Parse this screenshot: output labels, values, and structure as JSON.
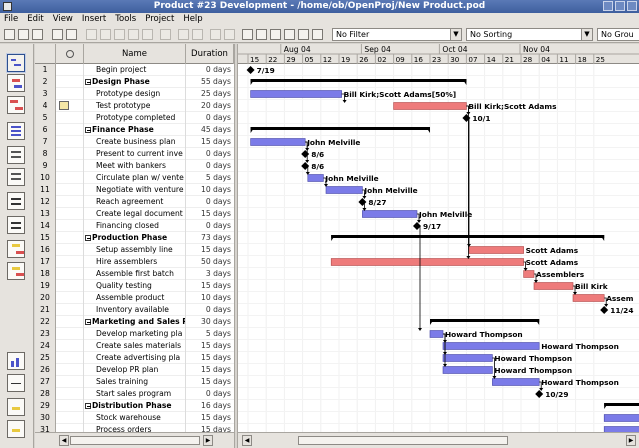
{
  "window": {
    "title": "Product #23 Development - /home/ob/OpenProj/New Product.pod"
  },
  "menu": [
    "File",
    "Edit",
    "View",
    "Insert",
    "Tools",
    "Project",
    "Help"
  ],
  "toolbar": {
    "filter": "No Filter",
    "sorting": "No Sorting",
    "grouping": "No Grou"
  },
  "left_views": [
    "gantt-view-icon",
    "network-view-icon",
    "wbs-view-icon",
    "rbs-view-icon",
    "task-usage-icon",
    "resource-usage-icon",
    "project-view-icon",
    "resource-view-icon",
    "histogram-icon",
    "charts-icon",
    "report-icon"
  ],
  "table": {
    "headers": {
      "info": "",
      "name": "Name",
      "duration": "Duration"
    },
    "rows": [
      {
        "id": "1",
        "name": "Begin project",
        "duration": "0 days",
        "level": 1,
        "summary": false,
        "note": false
      },
      {
        "id": "2",
        "name": "Design Phase",
        "duration": "55 days",
        "level": 0,
        "summary": true,
        "note": false
      },
      {
        "id": "3",
        "name": "Prototype design",
        "duration": "25 days",
        "level": 1,
        "summary": false,
        "note": false
      },
      {
        "id": "4",
        "name": "Test prototype",
        "duration": "20 days",
        "level": 1,
        "summary": false,
        "note": true
      },
      {
        "id": "5",
        "name": "Prototype completed",
        "duration": "0 days",
        "level": 1,
        "summary": false,
        "note": false
      },
      {
        "id": "6",
        "name": "Finance Phase",
        "duration": "45 days",
        "level": 0,
        "summary": true,
        "note": false
      },
      {
        "id": "7",
        "name": "Create business plan",
        "duration": "15 days",
        "level": 1,
        "summary": false,
        "note": false
      },
      {
        "id": "8",
        "name": "Present to current inve",
        "duration": "0 days",
        "level": 1,
        "summary": false,
        "note": false
      },
      {
        "id": "9",
        "name": "Meet with bankers",
        "duration": "0 days",
        "level": 1,
        "summary": false,
        "note": false
      },
      {
        "id": "10",
        "name": "Circulate plan w/ vente",
        "duration": "5 days",
        "level": 1,
        "summary": false,
        "note": false
      },
      {
        "id": "11",
        "name": "Negotiate with venture",
        "duration": "10 days",
        "level": 1,
        "summary": false,
        "note": false
      },
      {
        "id": "12",
        "name": "Reach agreement",
        "duration": "0 days",
        "level": 1,
        "summary": false,
        "note": false
      },
      {
        "id": "13",
        "name": "Create legal document",
        "duration": "15 days",
        "level": 1,
        "summary": false,
        "note": false
      },
      {
        "id": "14",
        "name": "Financing closed",
        "duration": "0 days",
        "level": 1,
        "summary": false,
        "note": false
      },
      {
        "id": "15",
        "name": "Production Phase",
        "duration": "73 days",
        "level": 0,
        "summary": true,
        "note": false
      },
      {
        "id": "16",
        "name": "Setup assembly line",
        "duration": "15 days",
        "level": 1,
        "summary": false,
        "note": false
      },
      {
        "id": "17",
        "name": "Hire assemblers",
        "duration": "50 days",
        "level": 1,
        "summary": false,
        "note": false
      },
      {
        "id": "18",
        "name": "Assemble first batch",
        "duration": "3 days",
        "level": 1,
        "summary": false,
        "note": false
      },
      {
        "id": "19",
        "name": "Quality testing",
        "duration": "15 days",
        "level": 1,
        "summary": false,
        "note": false
      },
      {
        "id": "20",
        "name": "Assemble product",
        "duration": "10 days",
        "level": 1,
        "summary": false,
        "note": false
      },
      {
        "id": "21",
        "name": "Inventory available",
        "duration": "0 days",
        "level": 1,
        "summary": false,
        "note": false
      },
      {
        "id": "22",
        "name": "Marketing and Sales P",
        "duration": "30 days",
        "level": 0,
        "summary": true,
        "note": false
      },
      {
        "id": "23",
        "name": "Develop marketing pla",
        "duration": "5 days",
        "level": 1,
        "summary": false,
        "note": false
      },
      {
        "id": "24",
        "name": "Create sales materials",
        "duration": "15 days",
        "level": 1,
        "summary": false,
        "note": false
      },
      {
        "id": "25",
        "name": "Create advertising pla",
        "duration": "15 days",
        "level": 1,
        "summary": false,
        "note": false
      },
      {
        "id": "26",
        "name": "Develop PR plan",
        "duration": "15 days",
        "level": 1,
        "summary": false,
        "note": false
      },
      {
        "id": "27",
        "name": "Sales training",
        "duration": "15 days",
        "level": 1,
        "summary": false,
        "note": false
      },
      {
        "id": "28",
        "name": "Start sales program",
        "duration": "0 days",
        "level": 1,
        "summary": false,
        "note": false
      },
      {
        "id": "29",
        "name": "Distribution Phase",
        "duration": "16 days",
        "level": 0,
        "summary": true,
        "note": false
      },
      {
        "id": "30",
        "name": "Stock warehouse",
        "duration": "15 days",
        "level": 1,
        "summary": false,
        "note": false
      },
      {
        "id": "31",
        "name": "Process orders",
        "duration": "15 days",
        "level": 1,
        "summary": false,
        "note": false
      }
    ]
  },
  "gantt": {
    "months": [
      "Aug 04",
      "Sep 04",
      "Oct 04",
      "Nov 04"
    ],
    "days": [
      "15",
      "22",
      "29",
      "05",
      "12",
      "19",
      "26",
      "02",
      "09",
      "16",
      "23",
      "30",
      "07",
      "14",
      "21",
      "28",
      "04",
      "11",
      "18",
      "25"
    ],
    "colors": {
      "task_normal": "#7b7be8",
      "task_critical": "#ee7b7b",
      "summary": "#000000",
      "link": "#000000"
    },
    "bars": [
      {
        "row": 1,
        "kind": "milestone",
        "day": 1,
        "label": "7/19"
      },
      {
        "row": 2,
        "kind": "summary",
        "start": 1,
        "end": 84
      },
      {
        "row": 3,
        "kind": "task",
        "start": 1,
        "end": 36,
        "critical": false,
        "label": "Bill Kirk;Scott Adams[50%]"
      },
      {
        "row": 4,
        "kind": "task",
        "start": 56,
        "end": 84,
        "critical": true,
        "label": "Bill Kirk;Scott Adams"
      },
      {
        "row": 5,
        "kind": "milestone",
        "day": 84,
        "label": "10/1"
      },
      {
        "row": 6,
        "kind": "summary",
        "start": 1,
        "end": 70
      },
      {
        "row": 7,
        "kind": "task",
        "start": 1,
        "end": 22,
        "critical": false,
        "label": "John Melville"
      },
      {
        "row": 8,
        "kind": "milestone",
        "day": 22,
        "label": "8/6"
      },
      {
        "row": 9,
        "kind": "milestone",
        "day": 22,
        "label": "8/6"
      },
      {
        "row": 10,
        "kind": "task",
        "start": 23,
        "end": 29,
        "critical": false,
        "label": "John Melville"
      },
      {
        "row": 11,
        "kind": "task",
        "start": 30,
        "end": 44,
        "critical": false,
        "label": "John Melville"
      },
      {
        "row": 12,
        "kind": "milestone",
        "day": 44,
        "label": "8/27"
      },
      {
        "row": 13,
        "kind": "task",
        "start": 44,
        "end": 65,
        "critical": false,
        "label": "John Melville"
      },
      {
        "row": 14,
        "kind": "milestone",
        "day": 65,
        "label": "9/17"
      },
      {
        "row": 15,
        "kind": "summary",
        "start": 32,
        "end": 137
      },
      {
        "row": 16,
        "kind": "task",
        "start": 85,
        "end": 106,
        "critical": true,
        "label": "Scott Adams"
      },
      {
        "row": 17,
        "kind": "task",
        "start": 32,
        "end": 106,
        "critical": true,
        "label": "Scott Adams"
      },
      {
        "row": 18,
        "kind": "task",
        "start": 106,
        "end": 110,
        "critical": true,
        "label": "Assemblers"
      },
      {
        "row": 19,
        "kind": "task",
        "start": 110,
        "end": 125,
        "critical": true,
        "label": "Bill Kirk"
      },
      {
        "row": 20,
        "kind": "task",
        "start": 125,
        "end": 137,
        "critical": true,
        "label": "Assem"
      },
      {
        "row": 21,
        "kind": "milestone",
        "day": 137,
        "label": "11/24"
      },
      {
        "row": 22,
        "kind": "summary",
        "start": 70,
        "end": 112
      },
      {
        "row": 23,
        "kind": "task",
        "start": 70,
        "end": 75,
        "critical": false,
        "label": "Howard Thompson"
      },
      {
        "row": 24,
        "kind": "task",
        "start": 75,
        "end": 112,
        "critical": false,
        "label": "Howard Thompson"
      },
      {
        "row": 25,
        "kind": "task",
        "start": 75,
        "end": 94,
        "critical": false,
        "label": "Howard Thompson"
      },
      {
        "row": 26,
        "kind": "task",
        "start": 75,
        "end": 94,
        "critical": false,
        "label": "Howard Thompson"
      },
      {
        "row": 27,
        "kind": "task",
        "start": 94,
        "end": 112,
        "critical": false,
        "label": "Howard Thompson"
      },
      {
        "row": 28,
        "kind": "milestone",
        "day": 112,
        "label": "10/29"
      },
      {
        "row": 29,
        "kind": "summary",
        "start": 137,
        "end": 160
      },
      {
        "row": 30,
        "kind": "task",
        "start": 137,
        "end": 160,
        "critical": false,
        "label": ""
      },
      {
        "row": 31,
        "kind": "task",
        "start": 137,
        "end": 160,
        "critical": false,
        "label": ""
      }
    ]
  }
}
